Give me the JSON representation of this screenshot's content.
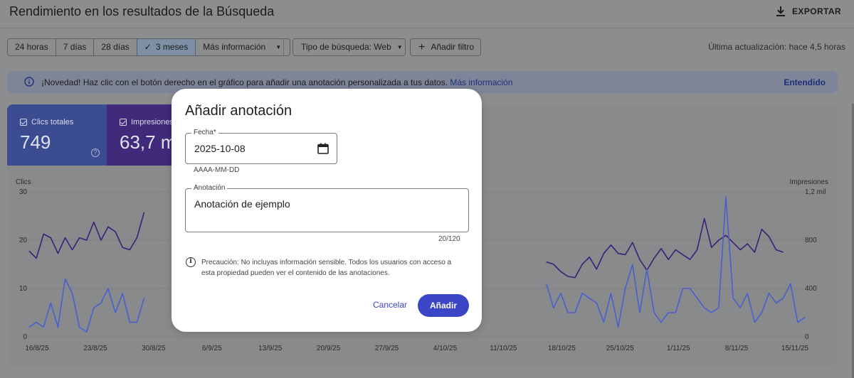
{
  "header": {
    "title": "Rendimiento en los resultados de la Búsqueda",
    "export_label": "EXPORTAR"
  },
  "filters": {
    "ranges": [
      "24 horas",
      "7 días",
      "28 días"
    ],
    "selected_range": "3 meses",
    "more": "Más información",
    "search_type": "Tipo de búsqueda: Web",
    "add_filter": "Añadir filtro",
    "last_update": "Última actualización: hace 4,5 horas"
  },
  "banner": {
    "text": "¡Novedad! Haz clic con el botón derecho en el gráfico para añadir una anotación personalizada a tus datos.",
    "link": "Más información",
    "dismiss": "Entendido"
  },
  "metrics": {
    "clicks": {
      "label": "Clics totales",
      "value": "749",
      "color": "#3b4c91"
    },
    "impressions": {
      "label": "Impresiones",
      "value": "63,7 m",
      "color": "#412a7a"
    }
  },
  "chart_data": {
    "type": "line",
    "y_left": {
      "label": "Clics",
      "ticks": [
        "30",
        "20",
        "10",
        "0"
      ],
      "range": [
        0,
        30
      ]
    },
    "y_right": {
      "label": "Impresiones",
      "ticks": [
        "1,2 mil",
        "800",
        "400",
        "0"
      ],
      "range": [
        0,
        1200
      ]
    },
    "x_ticks": [
      "16/8/25",
      "23/8/25",
      "30/8/25",
      "6/9/25",
      "13/9/25",
      "20/9/25",
      "27/9/25",
      "4/10/25",
      "11/10/25",
      "18/10/25",
      "25/10/25",
      "1/11/25",
      "8/11/25",
      "15/11/25"
    ],
    "series": [
      {
        "name": "Impresiones",
        "color": "#3d1f7a",
        "visible_segments": [
          [
            [
              0,
              710
            ],
            [
              1,
              650
            ],
            [
              2,
              850
            ],
            [
              3,
              820
            ],
            [
              4,
              690
            ],
            [
              5,
              820
            ],
            [
              6,
              720
            ],
            [
              7,
              820
            ],
            [
              8,
              800
            ],
            [
              9,
              950
            ],
            [
              10,
              800
            ],
            [
              11,
              910
            ],
            [
              12,
              870
            ],
            [
              13,
              740
            ],
            [
              14,
              720
            ],
            [
              15,
              820
            ],
            [
              16,
              1030
            ]
          ],
          [
            [
              72,
              620
            ],
            [
              73,
              600
            ],
            [
              74,
              540
            ],
            [
              75,
              500
            ],
            [
              76,
              490
            ],
            [
              77,
              600
            ],
            [
              78,
              660
            ],
            [
              79,
              560
            ],
            [
              80,
              690
            ],
            [
              81,
              760
            ],
            [
              82,
              690
            ],
            [
              83,
              680
            ],
            [
              84,
              780
            ],
            [
              85,
              640
            ],
            [
              86,
              550
            ],
            [
              87,
              650
            ],
            [
              88,
              730
            ],
            [
              89,
              640
            ],
            [
              90,
              720
            ],
            [
              91,
              680
            ],
            [
              92,
              640
            ],
            [
              93,
              720
            ],
            [
              94,
              980
            ],
            [
              95,
              740
            ],
            [
              96,
              800
            ],
            [
              97,
              840
            ],
            [
              98,
              780
            ],
            [
              99,
              720
            ],
            [
              100,
              770
            ],
            [
              101,
              700
            ],
            [
              102,
              890
            ],
            [
              103,
              830
            ],
            [
              104,
              720
            ],
            [
              105,
              700
            ]
          ]
        ]
      },
      {
        "name": "Clics",
        "color": "#4a5fcf",
        "visible_segments": [
          [
            [
              0,
              2
            ],
            [
              1,
              3
            ],
            [
              2,
              2
            ],
            [
              3,
              7
            ],
            [
              4,
              2
            ],
            [
              5,
              12
            ],
            [
              6,
              9
            ],
            [
              7,
              2
            ],
            [
              8,
              1
            ],
            [
              9,
              6
            ],
            [
              10,
              7
            ],
            [
              11,
              10
            ],
            [
              12,
              5
            ],
            [
              13,
              9
            ],
            [
              14,
              3
            ],
            [
              15,
              3
            ],
            [
              16,
              8
            ]
          ],
          [
            [
              72,
              11
            ],
            [
              73,
              6
            ],
            [
              74,
              9
            ],
            [
              75,
              5
            ],
            [
              76,
              5
            ],
            [
              77,
              9
            ],
            [
              78,
              8
            ],
            [
              79,
              7
            ],
            [
              80,
              3
            ],
            [
              81,
              9
            ],
            [
              82,
              2
            ],
            [
              83,
              10
            ],
            [
              84,
              15
            ],
            [
              85,
              5
            ],
            [
              86,
              14
            ],
            [
              87,
              5
            ],
            [
              88,
              3
            ],
            [
              89,
              5
            ],
            [
              90,
              5
            ],
            [
              91,
              10
            ],
            [
              92,
              10
            ],
            [
              93,
              8
            ],
            [
              94,
              6
            ],
            [
              95,
              5
            ],
            [
              96,
              6
            ],
            [
              97,
              29
            ],
            [
              98,
              8
            ],
            [
              99,
              6
            ],
            [
              100,
              9
            ],
            [
              101,
              3
            ],
            [
              102,
              5
            ],
            [
              103,
              9
            ],
            [
              104,
              7
            ],
            [
              105,
              8
            ],
            [
              106,
              11
            ],
            [
              107,
              3
            ],
            [
              108,
              4
            ]
          ]
        ]
      }
    ]
  },
  "modal": {
    "title": "Añadir anotación",
    "date_label": "Fecha",
    "date_required": "*",
    "date_value": "2025-10-08",
    "date_hint": "AAAA-MM-DD",
    "note_label": "Anotación",
    "note_value": "Anotación de ejemplo",
    "note_counter": "20/120",
    "warning": "Precaución: No incluyas información sensible. Todos los usuarios con acceso a esta propiedad pueden ver el contenido de las anotaciones.",
    "cancel": "Cancelar",
    "submit": "Añadir",
    "accent_color": "#3a46c5"
  }
}
